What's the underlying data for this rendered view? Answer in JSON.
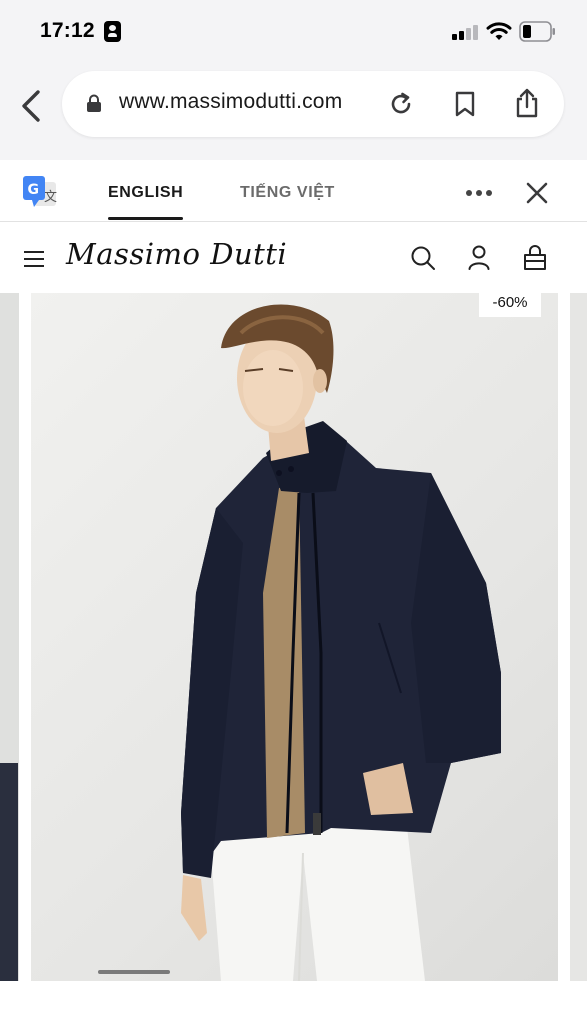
{
  "status_bar": {
    "time": "17:12",
    "icons": [
      "contact-card-icon",
      "signal-icon",
      "wifi-icon",
      "battery-icon"
    ]
  },
  "browser": {
    "url": "www.massimodutti.com",
    "icons": [
      "back-icon",
      "lock-icon",
      "reload-icon",
      "bookmark-icon",
      "share-icon"
    ]
  },
  "translate_bar": {
    "icon": "google-translate-icon",
    "tabs": [
      {
        "label": "ENGLISH",
        "selected": true
      },
      {
        "label": "TIẾNG VIỆT",
        "selected": false
      }
    ],
    "icons": [
      "more-icon",
      "close-icon"
    ]
  },
  "site_header": {
    "logo": "Massimo Dutti",
    "icons": [
      "menu-icon",
      "search-icon",
      "user-icon",
      "bag-icon"
    ]
  },
  "product": {
    "discount": "-60%",
    "image": "model-in-navy-jacket-image"
  },
  "colors": {
    "chrome_bg": "#f4f4f6",
    "jacket": "#1f2438",
    "sweater": "#a88c67",
    "text": "#111111"
  }
}
